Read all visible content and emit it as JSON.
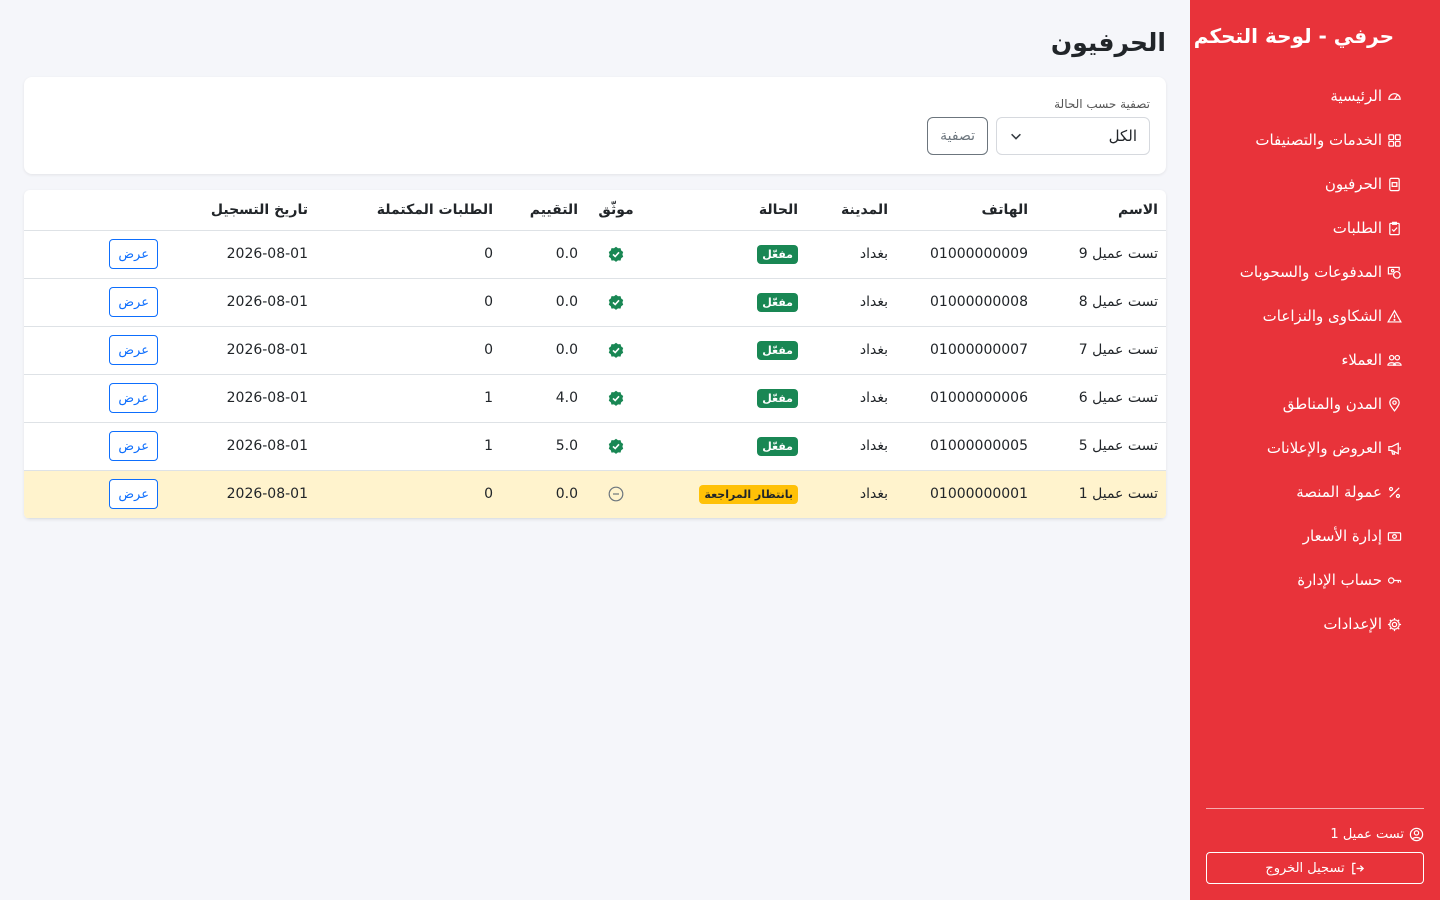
{
  "brand": {
    "title": "حرفي - لوحة التحكم"
  },
  "nav": [
    {
      "label": "الرئيسية",
      "icon": "speedometer-icon"
    },
    {
      "label": "الخدمات والتصنيفات",
      "icon": "grid-icon"
    },
    {
      "label": "الحرفيون",
      "icon": "badge-icon"
    },
    {
      "label": "الطلبات",
      "icon": "clipboard-check-icon"
    },
    {
      "label": "المدفوعات والسحوبات",
      "icon": "cash-coin-icon"
    },
    {
      "label": "الشكاوى والنزاعات",
      "icon": "warning-icon"
    },
    {
      "label": "العملاء",
      "icon": "people-icon"
    },
    {
      "label": "المدن والمناطق",
      "icon": "location-pin-icon"
    },
    {
      "label": "العروض والإعلانات",
      "icon": "megaphone-icon"
    },
    {
      "label": "عمولة المنصة",
      "icon": "percent-icon"
    },
    {
      "label": "إدارة الأسعار",
      "icon": "cash-icon"
    },
    {
      "label": "حساب الإدارة",
      "icon": "key-icon"
    },
    {
      "label": "الإعدادات",
      "icon": "gear-icon"
    }
  ],
  "footer": {
    "user": "تست عميل 1",
    "logout": "تسجيل الخروج"
  },
  "page": {
    "title": "الحرفيون"
  },
  "filter": {
    "label": "تصفية حسب الحالة",
    "selected": "الكل",
    "button": "تصفية"
  },
  "table": {
    "headers": {
      "name": "الاسم",
      "phone": "الهاتف",
      "city": "المدينة",
      "status": "الحالة",
      "verified": "موثّق",
      "rating": "التقييم",
      "completed": "الطلبات المكتملة",
      "registered": "تاريخ التسجيل"
    },
    "view_label": "عرض",
    "rows": [
      {
        "name": "تست عميل 9",
        "phone": "01000000009",
        "city": "بغداد",
        "status": "مفعّل",
        "status_type": "active",
        "verified": true,
        "rating": "0.0",
        "completed": "0",
        "registered": "2026-08-01"
      },
      {
        "name": "تست عميل 8",
        "phone": "01000000008",
        "city": "بغداد",
        "status": "مفعّل",
        "status_type": "active",
        "verified": true,
        "rating": "0.0",
        "completed": "0",
        "registered": "2026-08-01"
      },
      {
        "name": "تست عميل 7",
        "phone": "01000000007",
        "city": "بغداد",
        "status": "مفعّل",
        "status_type": "active",
        "verified": true,
        "rating": "0.0",
        "completed": "0",
        "registered": "2026-08-01"
      },
      {
        "name": "تست عميل 6",
        "phone": "01000000006",
        "city": "بغداد",
        "status": "مفعّل",
        "status_type": "active",
        "verified": true,
        "rating": "4.0",
        "completed": "1",
        "registered": "2026-08-01"
      },
      {
        "name": "تست عميل 5",
        "phone": "01000000005",
        "city": "بغداد",
        "status": "مفعّل",
        "status_type": "active",
        "verified": true,
        "rating": "5.0",
        "completed": "1",
        "registered": "2026-08-01"
      },
      {
        "name": "تست عميل 1",
        "phone": "01000000001",
        "city": "بغداد",
        "status": "بانتظار المراجعة",
        "status_type": "pending",
        "verified": false,
        "rating": "0.0",
        "completed": "0",
        "registered": "2026-08-01"
      }
    ]
  },
  "colors": {
    "sidebar": "#e8333a",
    "active_badge": "#198754",
    "pending_badge": "#ffc107",
    "pending_row": "#fff3cd",
    "primary": "#0d6efd"
  }
}
